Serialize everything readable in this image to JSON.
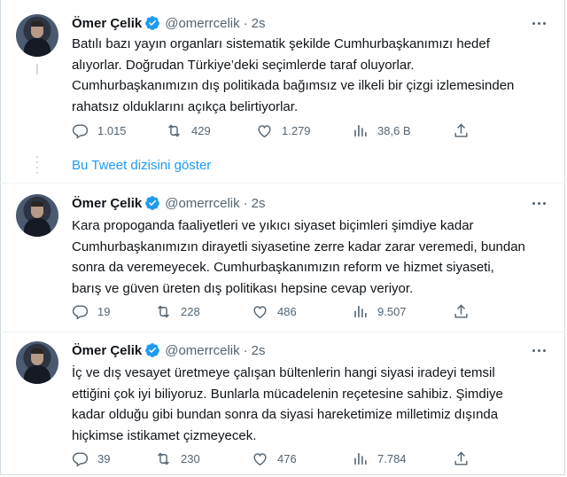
{
  "tweets": [
    {
      "name": "Ömer Çelik",
      "handle": "@omerrcelik",
      "separator": "·",
      "time": "2s",
      "text": "Batılı bazı yayın organları sistematik şekilde Cumhurbaşkanımızı hedef\nalıyorlar. Doğrudan Türkiye’deki seçimlerde taraf oluyorlar.\nCumhurbaşkanımızın dış politikada bağımsız ve ilkeli bir çizgi izlemesinden\nrahatsız olduklarını açıkça belirtiyorlar.",
      "replies": "1.015",
      "retweets": "429",
      "likes": "1.279",
      "views": "38,6 B"
    },
    {
      "name": "Ömer Çelik",
      "handle": "@omerrcelik",
      "separator": "·",
      "time": "2s",
      "text": "Kara propoganda faaliyetleri ve yıkıcı siyaset biçimleri şimdiye kadar\nCumhurbaşkanımızın dirayetli siyasetine zerre kadar zarar veremedi, bundan\nsonra da veremeyecek. Cumhurbaşkanımızın reform ve hizmet siyaseti,\nbarış ve güven üreten dış politikası hepsine cevap veriyor.",
      "replies": "19",
      "retweets": "228",
      "likes": "486",
      "views": "9.507"
    },
    {
      "name": "Ömer Çelik",
      "handle": "@omerrcelik",
      "separator": "·",
      "time": "2s",
      "text": "İç ve dış vesayet üretmeye çalışan bültenlerin hangi siyasi iradeyi temsil\nettiğini çok iyi biliyoruz. Bunlarla mücadelenin reçetesine sahibiz. Şimdiye\nkadar olduğu gibi bundan sonra da siyasi hareketimize milletimiz dışında\nhiçkimse istikamet çizmeyecek.",
      "replies": "39",
      "retweets": "230",
      "likes": "476",
      "views": "7.784"
    }
  ],
  "show_thread": "Bu Tweet dizisini göster",
  "colors": {
    "accent": "#1d9bf0",
    "text": "#0f1419",
    "secondary": "#536471",
    "border": "#cfd9de"
  },
  "icons": [
    "verified-badge-icon",
    "more-icon",
    "reply-icon",
    "retweet-icon",
    "like-icon",
    "views-icon",
    "share-icon"
  ]
}
